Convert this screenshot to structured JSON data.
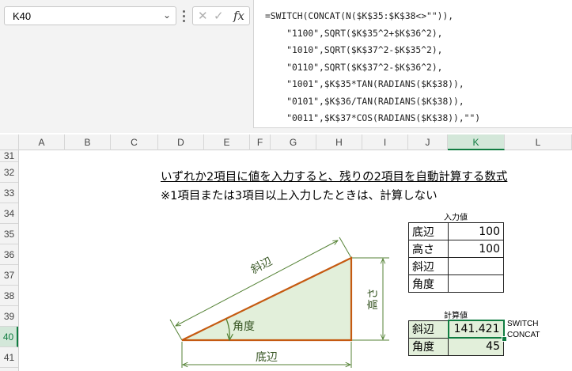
{
  "name_box": {
    "value": "K40"
  },
  "formula_bar": {
    "fx_label": "fx",
    "cancel_symbol": "✕",
    "enter_symbol": "✓",
    "formula": "=SWITCH(CONCAT(N($K$35:$K$38<>\"\")),\n    \"1100\",SQRT($K$35^2+$K$36^2),\n    \"1010\",SQRT($K$37^2-$K$35^2),\n    \"0110\",SQRT($K$37^2-$K$36^2),\n    \"1001\",$K$35*TAN(RADIANS($K$38)),\n    \"0101\",$K$36/TAN(RADIANS($K$38)),\n    \"0011\",$K$37*COS(RADIANS($K$38)),\"\")"
  },
  "columns": [
    "A",
    "B",
    "C",
    "D",
    "E",
    "F",
    "G",
    "H",
    "I",
    "J",
    "K",
    "L"
  ],
  "selected_column": "K",
  "rows": [
    "31",
    "32",
    "33",
    "34",
    "35",
    "36",
    "37",
    "38",
    "39",
    "40",
    "41"
  ],
  "selected_row": "40",
  "sheet": {
    "title_line1": "いずれか2項目に値を入力すると、残りの2項目を自動計算する数式",
    "title_line2": "※1項目または3項目以上入力したときは、計算しない",
    "input_caption": "入力値",
    "input_table": [
      {
        "label": "底辺",
        "value": "100"
      },
      {
        "label": "高さ",
        "value": "100"
      },
      {
        "label": "斜辺",
        "value": ""
      },
      {
        "label": "角度",
        "value": ""
      }
    ],
    "output_caption": "計算値",
    "output_table": [
      {
        "label": "斜辺",
        "value": "141.421"
      },
      {
        "label": "角度",
        "value": "45"
      }
    ],
    "note_lines": [
      "SWITCH",
      "CONCAT"
    ]
  },
  "diagram": {
    "hypotenuse_label": "斜辺",
    "height_label": "高さ",
    "base_label": "底辺",
    "angle_label": "角度",
    "triangle_stroke": "#c55a11",
    "triangle_fill": "#e2efda",
    "dimension_color": "#548235"
  },
  "colors": {
    "accent": "#107c41",
    "selected_header": "#d3e7d9",
    "output_fill": "#e2efda"
  }
}
